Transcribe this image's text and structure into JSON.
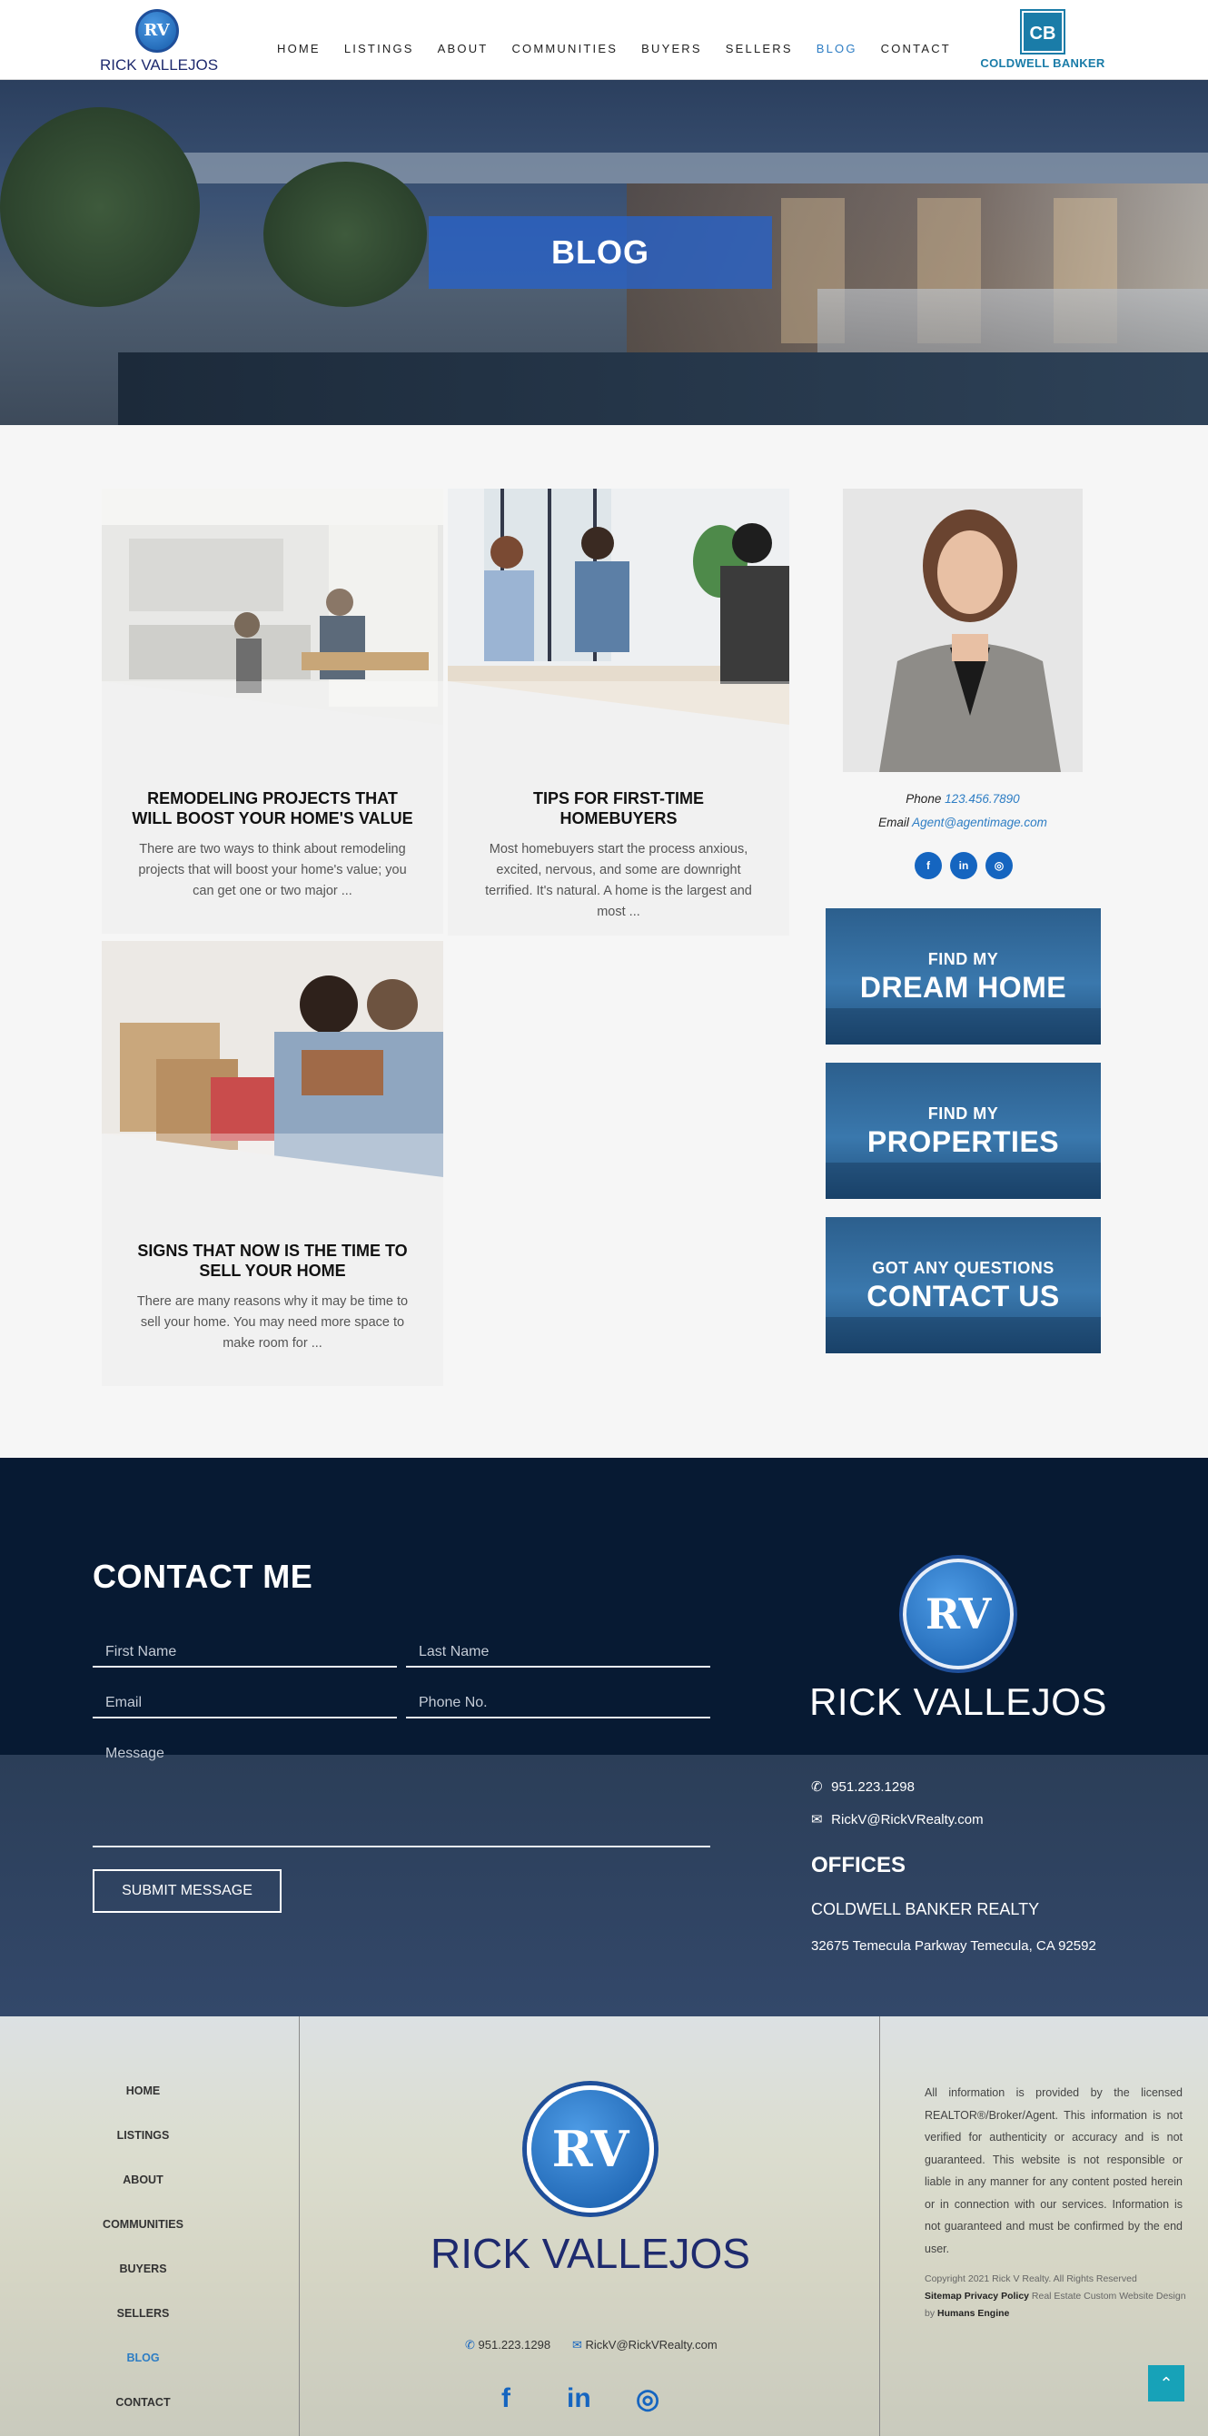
{
  "header": {
    "logo_initials": "RV",
    "logo_name": "RICK VALLEJOS",
    "nav": [
      {
        "label": "HOME",
        "active": false
      },
      {
        "label": "LISTINGS",
        "active": false
      },
      {
        "label": "ABOUT",
        "active": false
      },
      {
        "label": "COMMUNITIES",
        "active": false
      },
      {
        "label": "BUYERS",
        "active": false
      },
      {
        "label": "SELLERS",
        "active": false
      },
      {
        "label": "BLOG",
        "active": true
      },
      {
        "label": "CONTACT",
        "active": false
      }
    ],
    "brokerage_initials": "CB",
    "brokerage_name": "COLDWELL BANKER"
  },
  "hero": {
    "title": "BLOG"
  },
  "posts": [
    {
      "title": "REMODELING PROJECTS THAT WILL BOOST YOUR HOME'S VALUE",
      "excerpt": "There are two ways to think about remodeling projects that will boost your home's value; you can get one or two major ..."
    },
    {
      "title": "TIPS FOR FIRST-TIME HOMEBUYERS",
      "excerpt": "Most homebuyers start the process anxious, excited, nervous, and some are downright terrified. It's natural. A home is the largest and most ..."
    },
    {
      "title": "SIGNS THAT NOW IS THE TIME TO SELL YOUR HOME",
      "excerpt": "There are many reasons why it may be time to sell your home. You may need more space to make room for ..."
    }
  ],
  "agent": {
    "phone_label": "Phone",
    "phone": "123.456.7890",
    "email_label": "Email",
    "email": "Agent@agentimage.com",
    "social_icons": [
      "facebook-icon",
      "linkedin-icon",
      "instagram-icon"
    ],
    "social_glyphs": [
      "f",
      "in",
      "◎"
    ]
  },
  "ctas": [
    {
      "small": "FIND MY",
      "big": "DREAM HOME"
    },
    {
      "small": "FIND MY",
      "big": "PROPERTIES"
    },
    {
      "small": "GOT ANY QUESTIONS",
      "big": "CONTACT US"
    }
  ],
  "contact": {
    "heading": "CONTACT ME",
    "first_name_placeholder": "First Name",
    "last_name_placeholder": "Last Name",
    "email_placeholder": "Email",
    "phone_placeholder": "Phone No.",
    "message_placeholder": "Message",
    "submit_label": "SUBMIT MESSAGE",
    "logo_initials": "RV",
    "logo_name": "RICK VALLEJOS",
    "phone": "951.223.1298",
    "email": "RickV@RickVRealty.com",
    "offices_heading": "OFFICES",
    "office_name": "COLDWELL BANKER REALTY",
    "office_address": "32675 Temecula Parkway Temecula, CA 92592"
  },
  "footer": {
    "nav": [
      {
        "label": "HOME",
        "active": false
      },
      {
        "label": "LISTINGS",
        "active": false
      },
      {
        "label": "ABOUT",
        "active": false
      },
      {
        "label": "COMMUNITIES",
        "active": false
      },
      {
        "label": "BUYERS",
        "active": false
      },
      {
        "label": "SELLERS",
        "active": false
      },
      {
        "label": "BLOG",
        "active": true
      },
      {
        "label": "CONTACT",
        "active": false
      }
    ],
    "logo_initials": "RV",
    "logo_name": "RICK VALLEJOS",
    "phone": "951.223.1298",
    "email": "RickV@RickVRealty.com",
    "social_glyphs": [
      "f",
      "in",
      "◎"
    ],
    "disclaimer": "All information is provided by the licensed REALTOR®/Broker/Agent. This information is not verified for authenticity or accuracy and is not guaranteed. This website is not responsible or liable in any manner for any content posted herein or in connection with our services. Information is not guaranteed and must be confirmed by the end user.",
    "copyright": "Copyright 2021 Rick V Realty. All Rights Reserved",
    "sitemap": "Sitemap",
    "privacy": "Privacy Policy",
    "credit_text": "Real Estate Custom Website Design by",
    "credit_link": "Humans Engine",
    "to_top_glyph": "⌃"
  },
  "colors": {
    "accent": "#2d7dc4",
    "navy": "#071a33",
    "hero_banner": "#2962c4",
    "to_top": "#17a2b8"
  }
}
